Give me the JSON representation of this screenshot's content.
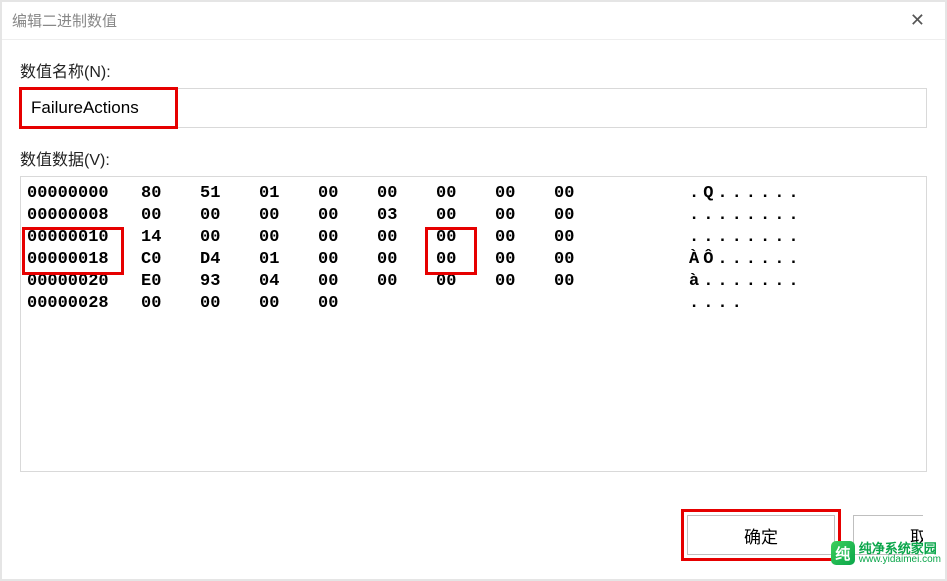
{
  "window": {
    "title": "编辑二进制数值"
  },
  "labels": {
    "name": "数值名称(N):",
    "data": "数值数据(V):"
  },
  "value_name": "FailureActions",
  "hex_rows": [
    {
      "offset": "00000000",
      "bytes": [
        "80",
        "51",
        "01",
        "00",
        "00",
        "00",
        "00",
        "00"
      ],
      "ascii": ".Q......"
    },
    {
      "offset": "00000008",
      "bytes": [
        "00",
        "00",
        "00",
        "00",
        "03",
        "00",
        "00",
        "00"
      ],
      "ascii": "........"
    },
    {
      "offset": "00000010",
      "bytes": [
        "14",
        "00",
        "00",
        "00",
        "00",
        "00",
        "00",
        "00"
      ],
      "ascii": "........"
    },
    {
      "offset": "00000018",
      "bytes": [
        "C0",
        "D4",
        "01",
        "00",
        "00",
        "00",
        "00",
        "00"
      ],
      "ascii": "ÀÔ......"
    },
    {
      "offset": "00000020",
      "bytes": [
        "E0",
        "93",
        "04",
        "00",
        "00",
        "00",
        "00",
        "00"
      ],
      "ascii": "à......."
    },
    {
      "offset": "00000028",
      "bytes": [
        "00",
        "00",
        "00",
        "00",
        "",
        "",
        "",
        ""
      ],
      "ascii": "...."
    }
  ],
  "buttons": {
    "ok": "确定",
    "cancel": "取消"
  },
  "watermark": {
    "icon": "纯",
    "cn": "纯净系统家园",
    "url": "www.yidaimei.com"
  }
}
